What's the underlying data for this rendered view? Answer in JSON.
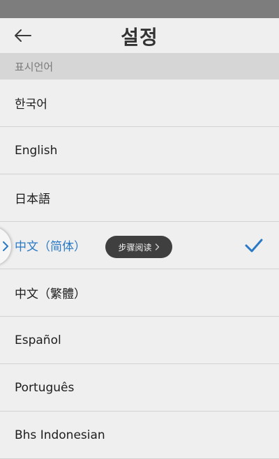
{
  "header": {
    "title": "설정"
  },
  "section": {
    "label": "표시언어"
  },
  "languages": [
    {
      "label": "한국어"
    },
    {
      "label": "English"
    },
    {
      "label": "日本語"
    },
    {
      "label": "中文（简体）"
    },
    {
      "label": "中文（繁體）"
    },
    {
      "label": "Español"
    },
    {
      "label": "Português"
    },
    {
      "label": "Bhs Indonesian"
    }
  ],
  "selected_language": "中文（简体）",
  "overlay": {
    "pill_label": "步骤阅读",
    "pill_icon": "chevron-right-icon",
    "edge_icon": "chevron-right-icon"
  },
  "colors": {
    "accent": "#2a79c4",
    "status_bar": "#7d7d7e",
    "background": "#efeff0",
    "section_bg": "#d6d6d7",
    "pill_bg": "#3f3f3f"
  }
}
